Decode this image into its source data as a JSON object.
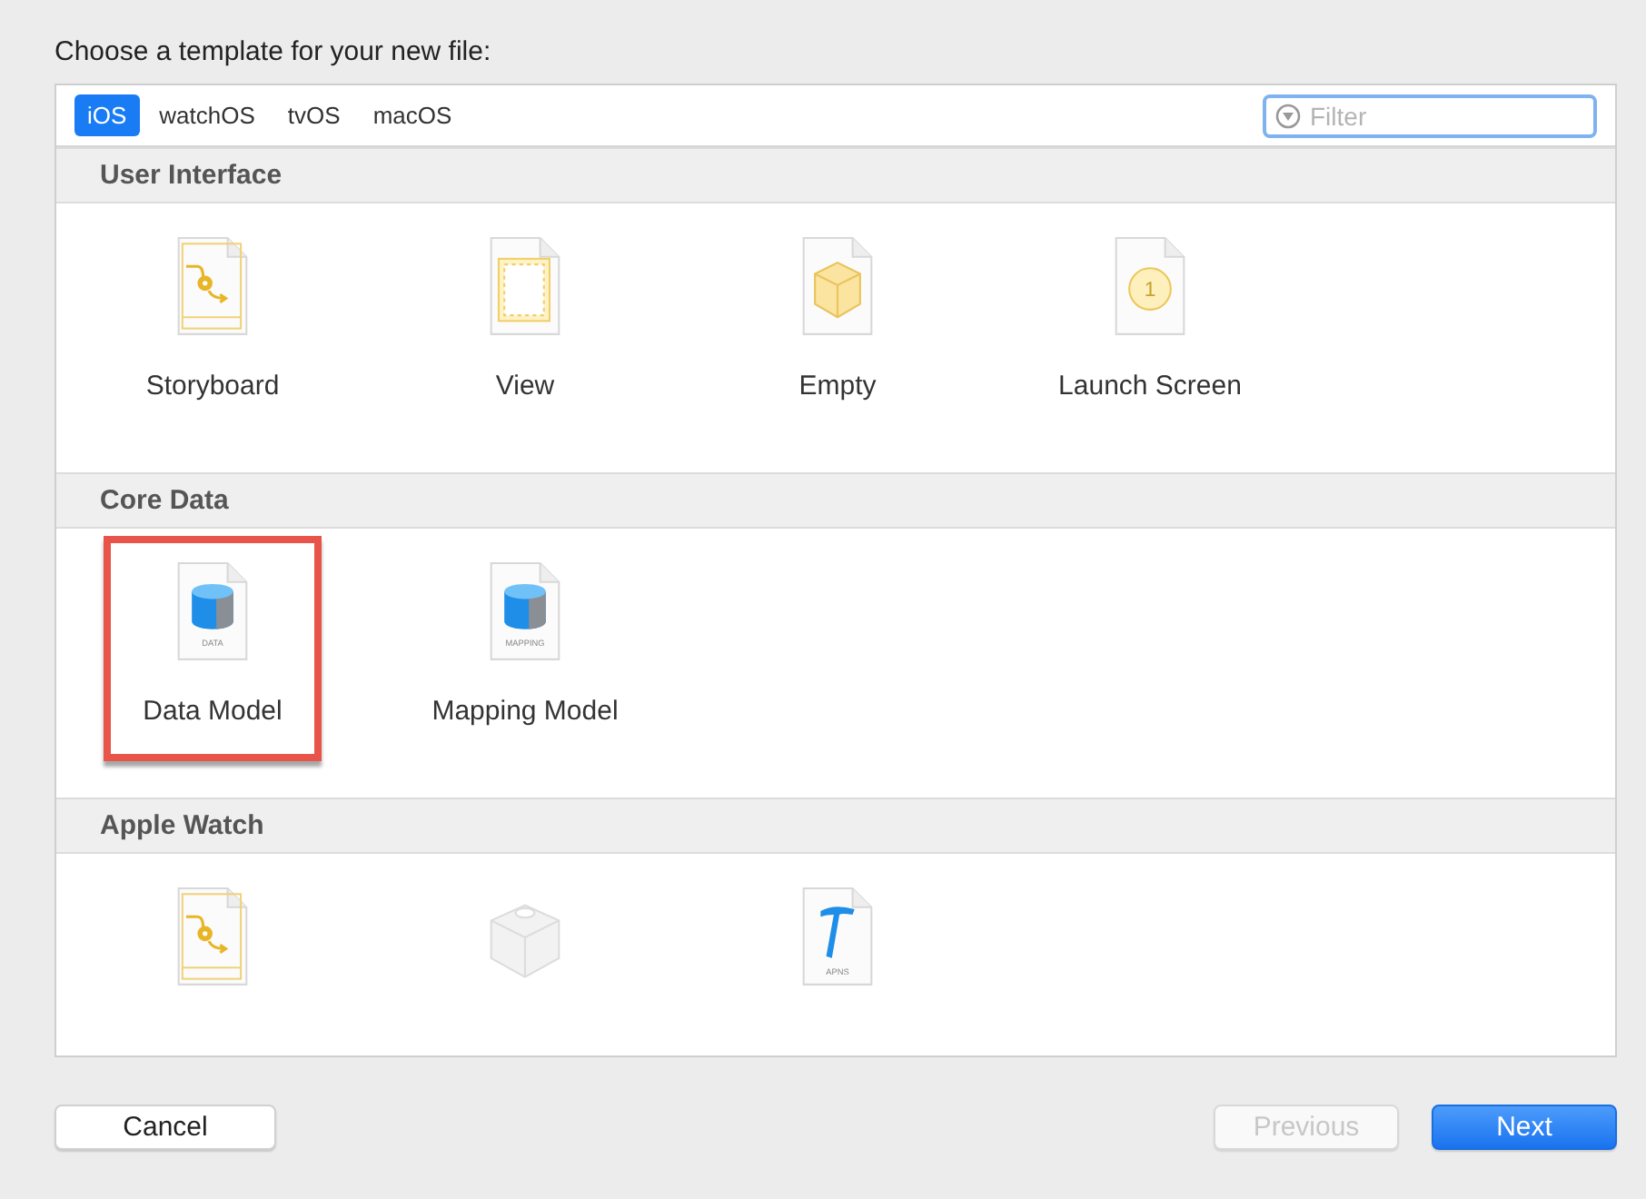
{
  "prompt": "Choose a template for your new file:",
  "platforms": [
    {
      "label": "iOS",
      "selected": true
    },
    {
      "label": "watchOS",
      "selected": false
    },
    {
      "label": "tvOS",
      "selected": false
    },
    {
      "label": "macOS",
      "selected": false
    }
  ],
  "filter": {
    "placeholder": "Filter"
  },
  "sections": [
    {
      "title": "User Interface",
      "items": [
        {
          "kind": "storyboard",
          "label": "Storyboard",
          "selected": false
        },
        {
          "kind": "view",
          "label": "View",
          "selected": false
        },
        {
          "kind": "empty",
          "label": "Empty",
          "selected": false
        },
        {
          "kind": "launch",
          "label": "Launch Screen",
          "badge": "1",
          "selected": false
        }
      ]
    },
    {
      "title": "Core Data",
      "items": [
        {
          "kind": "database",
          "label": "Data Model",
          "badge": "DATA",
          "selected": true
        },
        {
          "kind": "database",
          "label": "Mapping Model",
          "badge": "MAPPING",
          "selected": false
        }
      ]
    },
    {
      "title": "Apple Watch",
      "items": [
        {
          "kind": "storyboard",
          "selected": false
        },
        {
          "kind": "brick",
          "selected": false
        },
        {
          "kind": "hammer",
          "badge": "APNS",
          "selected": false
        }
      ]
    }
  ],
  "buttons": [
    {
      "label": "Cancel",
      "kind": "normal",
      "disabled": false
    },
    {
      "label": "Previous",
      "kind": "normal",
      "disabled": true
    },
    {
      "label": "Next",
      "kind": "primary",
      "disabled": false
    }
  ]
}
